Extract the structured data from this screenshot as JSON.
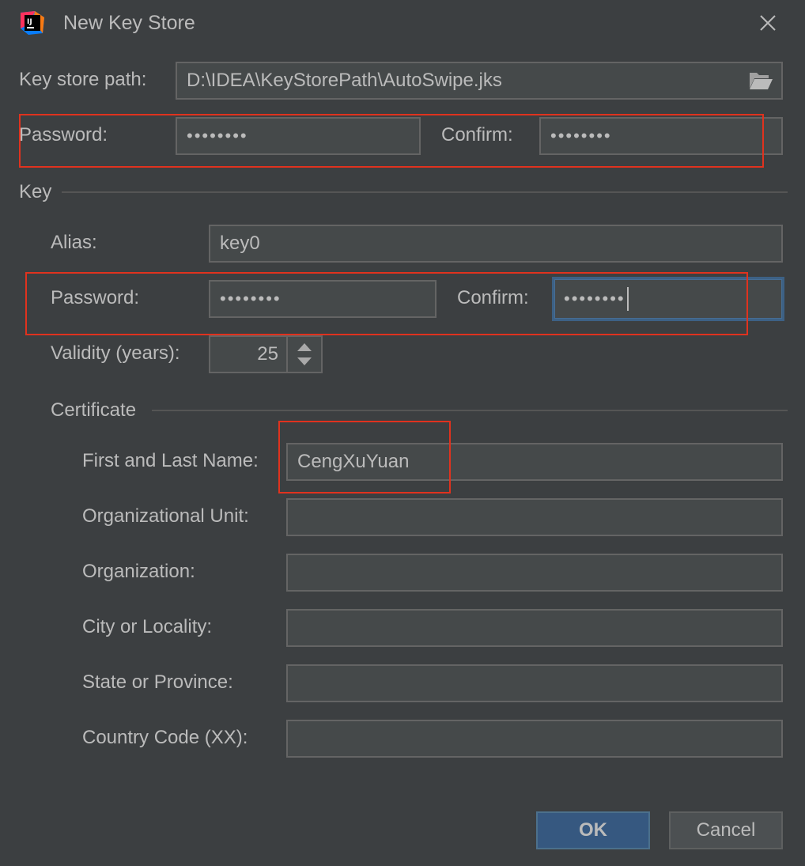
{
  "window": {
    "title": "New Key Store"
  },
  "keystore": {
    "path_label": "Key store path:",
    "path_value": "D:\\IDEA\\KeyStorePath\\AutoSwipe.jks",
    "password_label": "Password:",
    "password_mask": "••••••••",
    "confirm_label": "Confirm:",
    "confirm_mask": "••••••••"
  },
  "key": {
    "section_label": "Key",
    "alias_label": "Alias:",
    "alias_value": "key0",
    "password_label": "Password:",
    "password_mask": "••••••••",
    "confirm_label": "Confirm:",
    "confirm_mask": "••••••••",
    "validity_label": "Validity (years):",
    "validity_value": "25"
  },
  "certificate": {
    "section_label": "Certificate",
    "first_last_label": "First and Last Name:",
    "first_last_value": "CengXuYuan",
    "org_unit_label": "Organizational Unit:",
    "org_unit_value": "",
    "organization_label": "Organization:",
    "organization_value": "",
    "city_label": "City or Locality:",
    "city_value": "",
    "state_label": "State or Province:",
    "state_value": "",
    "country_label": "Country Code (XX):",
    "country_value": ""
  },
  "buttons": {
    "ok": "OK",
    "cancel": "Cancel"
  },
  "icons": {
    "app": "intellij-idea-icon",
    "close": "close-icon",
    "browse": "folder-open-icon",
    "spinner": "spinner-arrows-icon"
  },
  "colors": {
    "background": "#3c3f41",
    "field": "#45494a",
    "highlight_box": "#e0321e",
    "ok_button": "#365880",
    "focus_border": "#3d6185"
  }
}
